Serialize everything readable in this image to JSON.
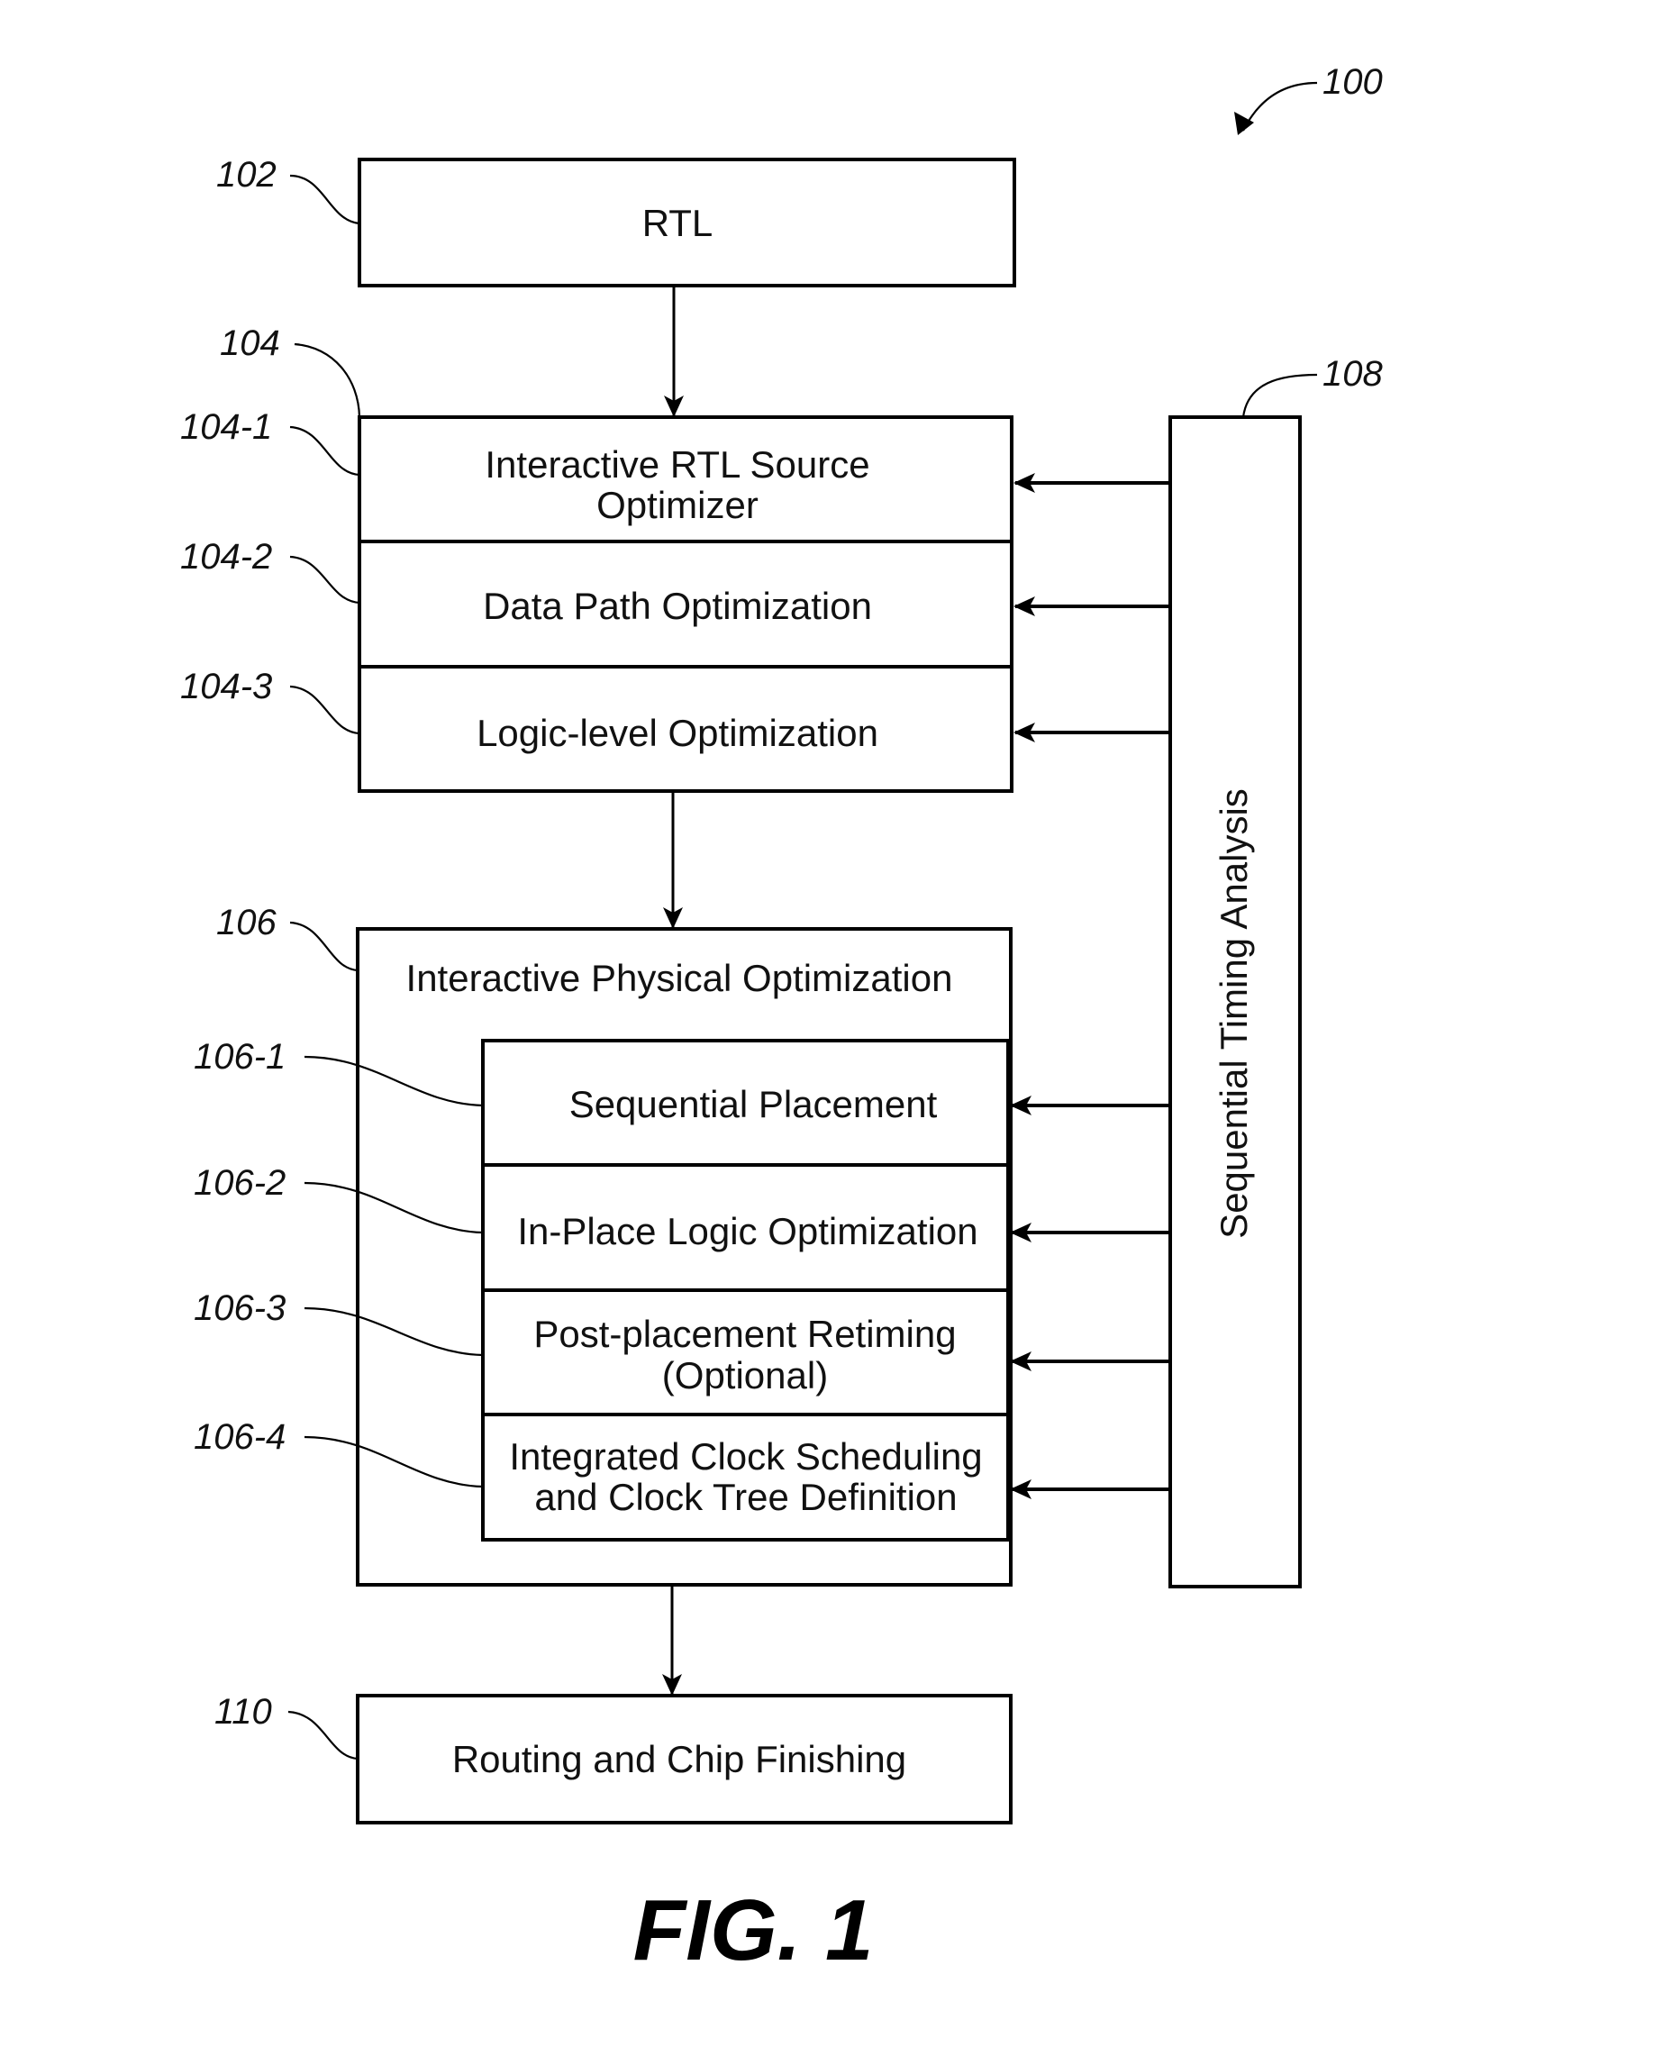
{
  "figure": {
    "ref": "100",
    "caption": "FIG. 1"
  },
  "blocks": {
    "rtl": {
      "ref": "102",
      "label": "RTL"
    },
    "logic_opt": {
      "ref": "104",
      "stages": [
        {
          "ref": "104-1",
          "lines": [
            "Interactive RTL Source",
            "Optimizer"
          ]
        },
        {
          "ref": "104-2",
          "lines": [
            "Data Path Optimization"
          ]
        },
        {
          "ref": "104-3",
          "lines": [
            "Logic-level Optimization"
          ]
        }
      ]
    },
    "physical_opt": {
      "ref": "106",
      "title": "Interactive Physical Optimization",
      "stages": [
        {
          "ref": "106-1",
          "lines": [
            "Sequential Placement"
          ]
        },
        {
          "ref": "106-2",
          "lines": [
            "In-Place Logic Optimization"
          ]
        },
        {
          "ref": "106-3",
          "lines": [
            "Post-placement Retiming",
            "(Optional)"
          ]
        },
        {
          "ref": "106-4",
          "lines": [
            "Integrated Clock Scheduling",
            "and Clock Tree Definition"
          ]
        }
      ]
    },
    "timing": {
      "ref": "108",
      "label": "Sequential Timing Analysis"
    },
    "routing": {
      "ref": "110",
      "label": "Routing and Chip Finishing"
    }
  }
}
